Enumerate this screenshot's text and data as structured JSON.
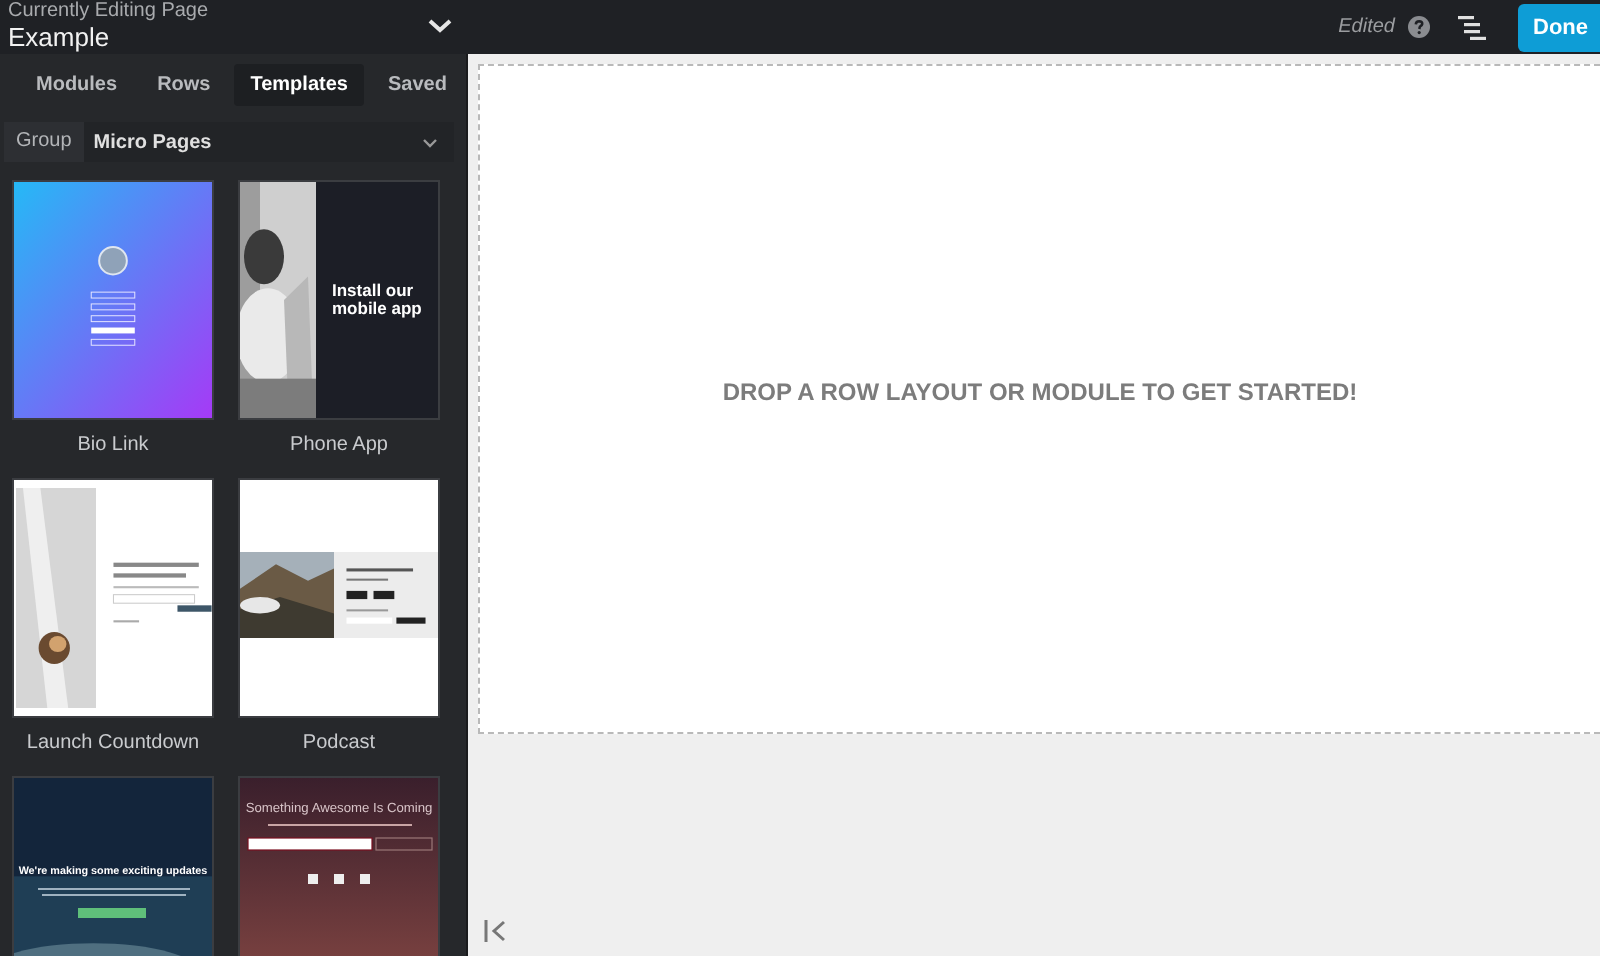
{
  "header": {
    "subtitle": "Currently Editing Page",
    "title": "Example"
  },
  "toolbar": {
    "status": "Edited",
    "done": "Done"
  },
  "tabs": [
    {
      "label": "Modules",
      "selected": false
    },
    {
      "label": "Rows",
      "selected": false
    },
    {
      "label": "Templates",
      "selected": true
    },
    {
      "label": "Saved",
      "selected": false
    }
  ],
  "filter": {
    "label": "Group",
    "value": "Micro Pages"
  },
  "templates": [
    {
      "name": "Bio Link",
      "kind": "bio"
    },
    {
      "name": "Phone App",
      "kind": "phone",
      "headline": "Install our mobile app"
    },
    {
      "name": "Launch Countdown",
      "kind": "countdown"
    },
    {
      "name": "Podcast",
      "kind": "podcast"
    },
    {
      "kind": "updates",
      "headline": "We're making some exciting updates"
    },
    {
      "kind": "coming",
      "headline": "Something Awesome Is Coming"
    }
  ],
  "canvas": {
    "message": "DROP A ROW LAYOUT OR MODULE TO GET STARTED!"
  }
}
